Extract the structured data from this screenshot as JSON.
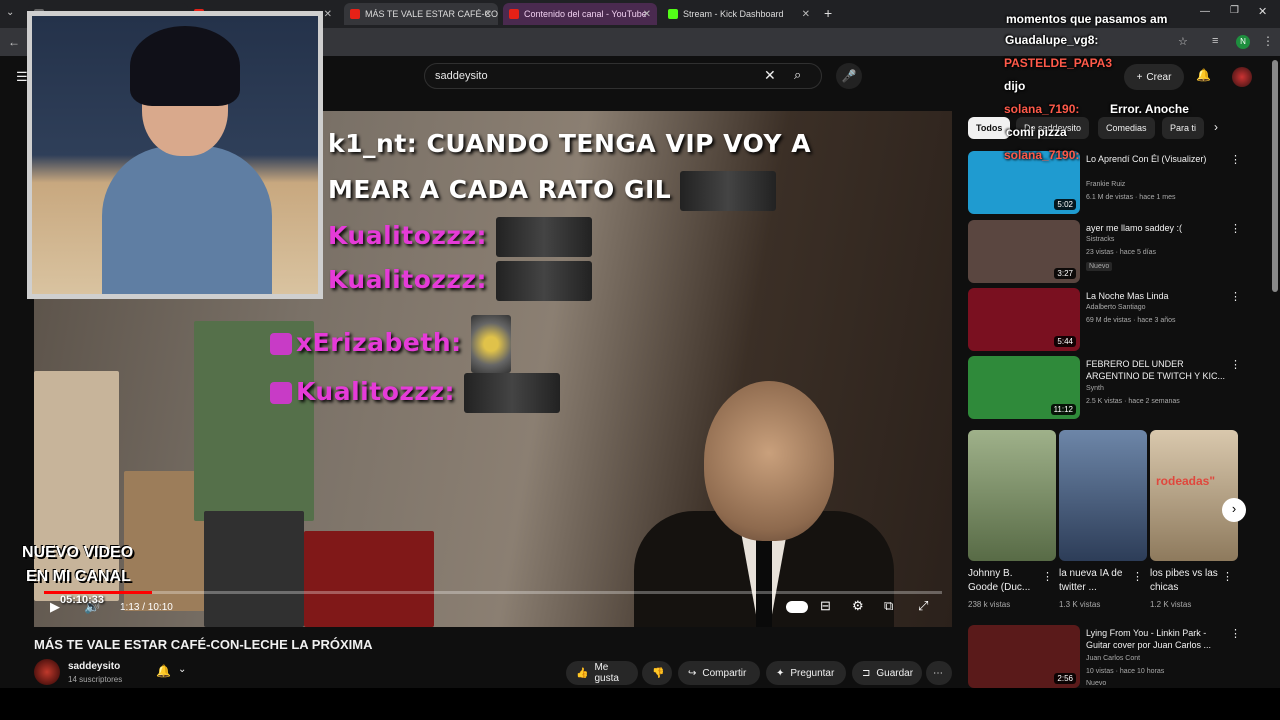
{
  "browser": {
    "tabs": [
      {
        "label": "",
        "active": false
      },
      {
        "label": "",
        "active": false
      },
      {
        "label": "MÁS TE VALE ESTAR CAFÉ-CON",
        "active": true
      },
      {
        "label": "Contenido del canal - YouTube",
        "active": false
      },
      {
        "label": "Stream - Kick Dashboard",
        "active": false
      }
    ],
    "profile_initial": "N"
  },
  "youtube": {
    "search_value": "saddeysito",
    "create_label": "Crear"
  },
  "overlay_chat": [
    {
      "text": "momentos que pasamos am",
      "color": "white"
    },
    {
      "text": "Guadalupe_vg8:",
      "color": "white"
    },
    {
      "text": "PASTELDE_PAPA3",
      "color": "red"
    },
    {
      "text": "dijo",
      "color": "white"
    },
    {
      "text": "solana_7190:",
      "color": "red"
    },
    {
      "text": "Error. Anoche",
      "color": "white"
    },
    {
      "text": "comi pizza",
      "color": "white"
    },
    {
      "text": "solana_7190:",
      "color": "red"
    }
  ],
  "video_chat": {
    "line1_user": "k1_nt:",
    "line1_text": "CUANDO TENGA VIP VOY A",
    "line2_text": "MEAR A CADA RATO GIL",
    "line3_user": "Kualitozzz:",
    "line4_user": "Kualitozzz:",
    "line5_user": "xErizabeth:",
    "line6_user": "Kualitozzz:"
  },
  "video_overlay": {
    "line1": "NUEVO VIDEO",
    "line2": "EN MI CANAL",
    "timer": "05:10:33"
  },
  "player": {
    "time": "1:13 / 10:10",
    "progress": 0.12
  },
  "video": {
    "title": "MÁS TE VALE ESTAR CAFÉ-CON-LECHE LA PRÓXIMA",
    "channel": "saddeysito",
    "subs": "14 suscriptores",
    "actions": {
      "like": "Me gusta",
      "share": "Compartir",
      "ask": "Preguntar",
      "save": "Guardar"
    }
  },
  "filters": [
    "Todos",
    "De saddeysito",
    "Comedias",
    "Para ti"
  ],
  "recommendations": [
    {
      "title": "Lo Aprendí Con Él (Visualizer)",
      "channel": "Frankie Ruiz",
      "meta": "6.1 M de vistas · hace 1 mes",
      "duration": "5:02",
      "thumb_color": "#1f9bd0"
    },
    {
      "title": "ayer me llamo saddey :(",
      "channel": "Sistracks",
      "meta": "23 vistas · hace 5 días",
      "duration": "3:27",
      "badge": "Nuevo",
      "thumb_color": "#5a4640"
    },
    {
      "title": "La Noche Mas Linda",
      "channel": "Adalberto Santiago",
      "meta": "69 M de vistas · hace 3 años",
      "duration": "5:44",
      "thumb_color": "#7a1020"
    },
    {
      "title": "FEBRERO DEL UNDER ARGENTINO DE TWITCH Y KIC...",
      "channel": "Synth",
      "meta": "2.5 K vistas · hace 2 semanas",
      "duration": "11:12",
      "thumb_color": "#2f8a3a"
    },
    {
      "title": "Lying From You - Linkin Park - Guitar cover por Juan Carlos ...",
      "channel": "Juan Carlos Cont",
      "meta": "10 vistas · hace 10 horas",
      "duration": "2:56",
      "badge": "Nuevo",
      "thumb_color": "#5a1a1a"
    }
  ],
  "shorts": [
    {
      "title": "Johnny B. Goode (Duc...",
      "views": "238 k vistas",
      "color": "#7d8a63"
    },
    {
      "title": "la nueva IA de twitter ...",
      "views": "1.3 K vistas",
      "color": "#5a6d8c"
    },
    {
      "title": "los pibes vs las chicas",
      "views": "1.2 K vistas",
      "color": "#b8a489",
      "overlay": "rodeadas\""
    }
  ]
}
